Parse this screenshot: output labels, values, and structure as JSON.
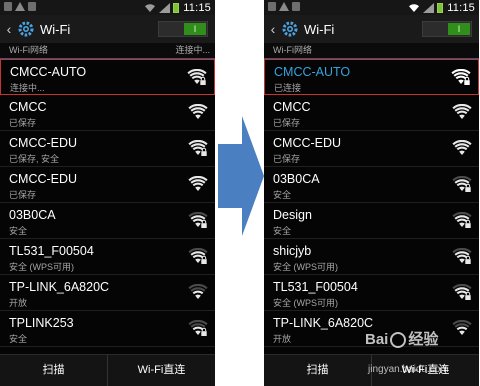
{
  "left": {
    "status_time": "11:15",
    "title": "Wi-Fi",
    "toggle_label": "I",
    "section": {
      "label": "Wi-Fi网络",
      "right": "连接中..."
    },
    "networks": [
      {
        "name": "CMCC-AUTO",
        "status": "连接中...",
        "selected": true,
        "locked": true,
        "strength": 4
      },
      {
        "name": "CMCC",
        "status": "已保存",
        "locked": false,
        "strength": 4
      },
      {
        "name": "CMCC-EDU",
        "status": "已保存, 安全",
        "locked": true,
        "strength": 4
      },
      {
        "name": "CMCC-EDU",
        "status": "已保存",
        "locked": false,
        "strength": 4
      },
      {
        "name": "03B0CA",
        "status": "安全",
        "locked": true,
        "strength": 3
      },
      {
        "name": "TL531_F00504",
        "status": "安全 (WPS可用)",
        "locked": true,
        "strength": 3
      },
      {
        "name": "TP-LINK_6A820C",
        "status": "开放",
        "locked": false,
        "strength": 2
      },
      {
        "name": "TPLINK253",
        "status": "安全",
        "locked": true,
        "strength": 2
      }
    ],
    "bottom": {
      "scan": "扫描",
      "direct": "Wi-Fi直连"
    }
  },
  "right": {
    "status_time": "11:15",
    "title": "Wi-Fi",
    "toggle_label": "I",
    "section": {
      "label": "Wi-Fi网络",
      "right": ""
    },
    "networks": [
      {
        "name": "CMCC-AUTO",
        "status": "已连接",
        "selected": true,
        "locked": true,
        "strength": 4,
        "connected": true
      },
      {
        "name": "CMCC",
        "status": "已保存",
        "locked": false,
        "strength": 4
      },
      {
        "name": "CMCC-EDU",
        "status": "已保存",
        "locked": false,
        "strength": 4
      },
      {
        "name": "03B0CA",
        "status": "安全",
        "locked": true,
        "strength": 3
      },
      {
        "name": "Design",
        "status": "安全",
        "locked": true,
        "strength": 3
      },
      {
        "name": "shicjyb",
        "status": "安全 (WPS可用)",
        "locked": true,
        "strength": 3
      },
      {
        "name": "TL531_F00504",
        "status": "安全 (WPS可用)",
        "locked": true,
        "strength": 3
      },
      {
        "name": "TP-LINK_6A820C",
        "status": "开放",
        "locked": false,
        "strength": 2
      }
    ],
    "bottom": {
      "scan": "扫描",
      "direct": "Wi-Fi直连"
    }
  },
  "watermark": {
    "brand": "Bai",
    "brand2": "经验",
    "url": "jingyan.baidu.com"
  },
  "colors": {
    "accent_blue": "#37a2dc",
    "selection_red": "#c8332f",
    "toggle_green": "#2f8f1a",
    "arrow_blue": "#4a7fc1",
    "wifi_icon": "#e8e8e8"
  }
}
